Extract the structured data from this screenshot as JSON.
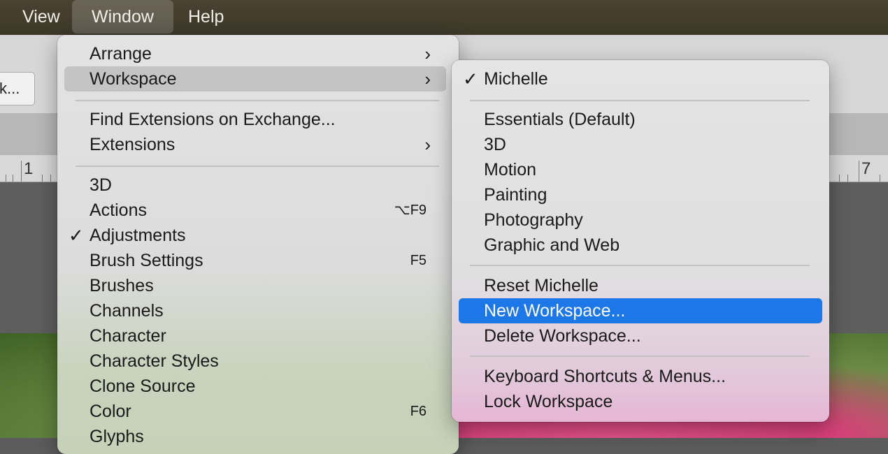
{
  "menubar": {
    "items": [
      {
        "label": "View"
      },
      {
        "label": "Window"
      },
      {
        "label": "Help"
      }
    ]
  },
  "toolbar": {
    "partial_button_label": "k..."
  },
  "ruler": {
    "labels": [
      "1",
      "7"
    ]
  },
  "window_menu": {
    "items": [
      {
        "label": "Arrange",
        "submenu": true
      },
      {
        "label": "Workspace",
        "submenu": true,
        "highlighted": true
      },
      {
        "label": "Find Extensions on Exchange..."
      },
      {
        "label": "Extensions",
        "submenu": true
      },
      {
        "label": "3D"
      },
      {
        "label": "Actions",
        "shortcut": "⌥F9"
      },
      {
        "label": "Adjustments",
        "checked": true
      },
      {
        "label": "Brush Settings",
        "shortcut": "F5"
      },
      {
        "label": "Brushes"
      },
      {
        "label": "Channels"
      },
      {
        "label": "Character"
      },
      {
        "label": "Character Styles"
      },
      {
        "label": "Clone Source"
      },
      {
        "label": "Color",
        "shortcut": "F6"
      },
      {
        "label": "Glyphs"
      }
    ],
    "chevron": "›",
    "checkmark": "✓"
  },
  "workspace_menu": {
    "items": [
      {
        "label": "Michelle",
        "checked": true
      },
      {
        "label": "Essentials (Default)"
      },
      {
        "label": "3D"
      },
      {
        "label": "Motion"
      },
      {
        "label": "Painting"
      },
      {
        "label": "Photography"
      },
      {
        "label": "Graphic and Web"
      },
      {
        "label": "Reset Michelle"
      },
      {
        "label": "New Workspace...",
        "selected": true
      },
      {
        "label": "Delete Workspace..."
      },
      {
        "label": "Keyboard Shortcuts & Menus..."
      },
      {
        "label": "Lock Workspace"
      }
    ],
    "checkmark": "✓"
  },
  "colors": {
    "selection": "#1e77e6",
    "menubar": "#4a4232"
  }
}
